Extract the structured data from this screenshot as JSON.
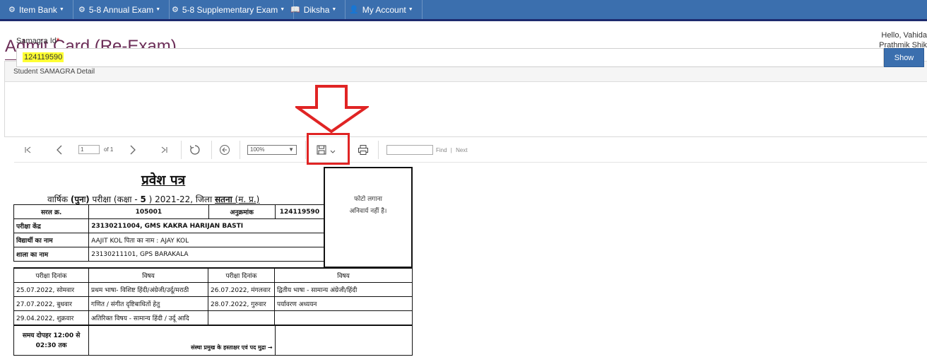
{
  "navbar": {
    "items": [
      {
        "label": "Item Bank"
      },
      {
        "label": "5-8 Annual Exam"
      },
      {
        "label": "5-8 Supplementary Exam"
      },
      {
        "label": "Diksha"
      },
      {
        "label": "My Account"
      }
    ]
  },
  "user": {
    "hello": "Hello, Vahida",
    "org": "Prathmik Shik"
  },
  "page": {
    "title": "Admit Card (Re-Exam)"
  },
  "panel": {
    "heading": "Student SAMAGRA Detail",
    "field_label": "Samagra Id",
    "required_mark": "*",
    "samagra_value": "124119590",
    "show_label": "Show"
  },
  "viewer": {
    "page_current": "1",
    "page_of": "of 1",
    "zoom": "100%",
    "find_label": "Find",
    "next_label": "Next",
    "find_sep": "|"
  },
  "card": {
    "title": "प्रवेश पत्र",
    "sub_a": "वार्षिक ",
    "sub_b": "(पुनः)",
    "sub_c": " परीक्षा (कक्षा - ",
    "sub_d": "5",
    "sub_e": " ) 2021-22, जिला ",
    "sub_f": "सतना",
    "sub_g": "  (म. प्र.)",
    "photo_line1": "फोटो लगाना",
    "photo_line2": "अनिवार्य नहीं है।",
    "serial_label": "सरल क्र.",
    "serial_value": "105001",
    "roll_label": "अनुक्रमांक",
    "roll_value": "124119590",
    "centre_label": "परीक्षा केंद्र",
    "centre_value": "23130211004, GMS KAKRA HARIJAN BASTI",
    "student_label": "विद्यार्थी का नाम",
    "student_value": "AAJIT KOL   पिता का नाम : AJAY KOL",
    "school_label": "शाला का नाम",
    "school_value": "23130211101, GPS BARAKALA",
    "date_header": "परीक्षा दिनांक",
    "subject_header": "विषय",
    "schedule": [
      {
        "d1": "25.07.2022, सोमवार",
        "s1": "प्रथम भाषा- विशिष्ट हिंदी/अंग्रेजी/उर्दू/मराठी",
        "d2": "26.07.2022, मंगलवार",
        "s2": "द्वितीय भाषा - सामान्य अंग्रेजी/हिंदी"
      },
      {
        "d1": "27.07.2022, बुधवार",
        "s1": "गणित / संगीत दृष्टिबाधितों हेतु",
        "d2": "28.07.2022, गुरुवार",
        "s2": "पर्यावरण अध्ययन"
      },
      {
        "d1": "29.04.2022, शुक्रवार",
        "s1": "अतिरिक्त विषय - सामान्य हिंदी / उर्दू आदि",
        "d2": "",
        "s2": ""
      }
    ],
    "time_text": "समय दोपहर 12:00 से 02:30 तक",
    "sign_text": "संस्था प्रमुख के हस्ताक्षर एवं पद मुद्रा →"
  }
}
